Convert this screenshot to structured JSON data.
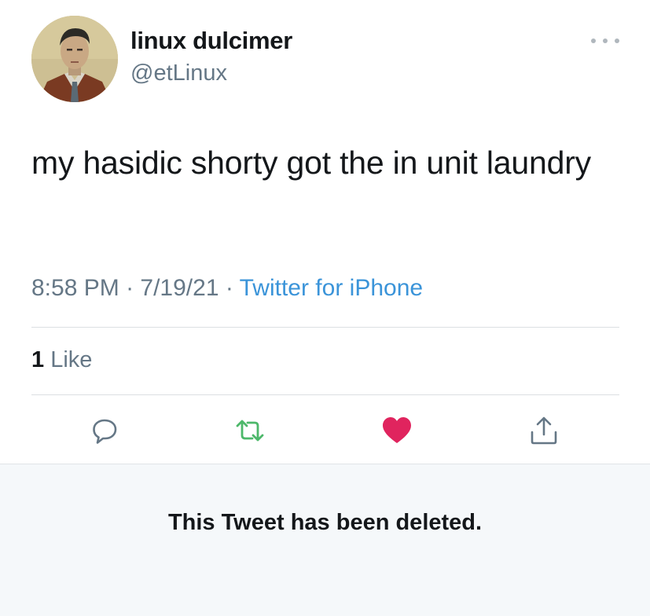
{
  "tweet": {
    "author": {
      "display_name": "linux dulcimer",
      "handle": "@etLinux",
      "avatar_icon": "portrait-avatar"
    },
    "more_icon": "more-options-icon",
    "text": "my hasidic shorty got the in unit laundry",
    "time": "8:58 PM",
    "date": "7/19/21",
    "separator": " · ",
    "source": "Twitter for iPhone",
    "likes": {
      "count": "1",
      "label": "Like"
    },
    "actions": [
      {
        "name": "reply-icon",
        "color": "#657786"
      },
      {
        "name": "retweet-icon",
        "color": "#4db86a"
      },
      {
        "name": "like-heart-icon",
        "color": "#e0245e"
      },
      {
        "name": "share-icon",
        "color": "#657786"
      }
    ]
  },
  "notice": {
    "text": "This Tweet has been deleted."
  },
  "colors": {
    "link": "#3b94d9",
    "muted": "#657786",
    "like": "#e0245e",
    "retweet": "#4db86a",
    "notice_bg": "#f5f8fa"
  }
}
